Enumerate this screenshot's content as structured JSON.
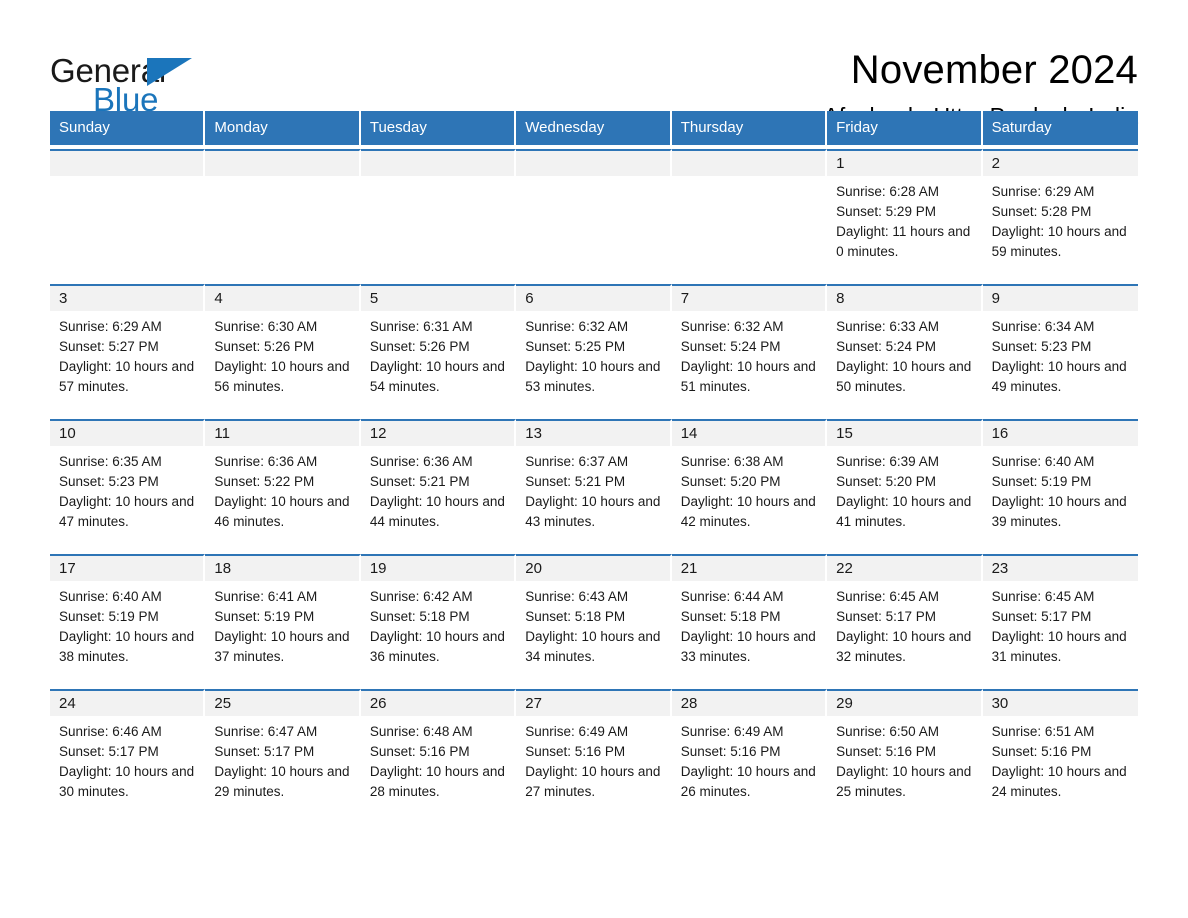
{
  "brand": {
    "name_part1": "General",
    "name_part2": "Blue",
    "triangle_color": "#1b75bb"
  },
  "header": {
    "title": "November 2024",
    "subtitle": "Afzalgarh, Uttar Pradesh, India"
  },
  "theme": {
    "header_blue": "#2e75b6",
    "band_gray": "#f2f2f2",
    "text_black": "#1a1a1a",
    "page_background": "#ffffff"
  },
  "weekday_headers": [
    "Sunday",
    "Monday",
    "Tuesday",
    "Wednesday",
    "Thursday",
    "Friday",
    "Saturday"
  ],
  "labels": {
    "sunrise_prefix": "Sunrise: ",
    "sunset_prefix": "Sunset: ",
    "daylight_prefix": "Daylight: "
  },
  "weeks": [
    [
      {
        "day": "",
        "sunrise": "",
        "sunset": "",
        "daylight": "",
        "empty": true
      },
      {
        "day": "",
        "sunrise": "",
        "sunset": "",
        "daylight": "",
        "empty": true
      },
      {
        "day": "",
        "sunrise": "",
        "sunset": "",
        "daylight": "",
        "empty": true
      },
      {
        "day": "",
        "sunrise": "",
        "sunset": "",
        "daylight": "",
        "empty": true
      },
      {
        "day": "",
        "sunrise": "",
        "sunset": "",
        "daylight": "",
        "empty": true
      },
      {
        "day": "1",
        "sunrise": "Sunrise: 6:28 AM",
        "sunset": "Sunset: 5:29 PM",
        "daylight": "Daylight: 11 hours and 0 minutes."
      },
      {
        "day": "2",
        "sunrise": "Sunrise: 6:29 AM",
        "sunset": "Sunset: 5:28 PM",
        "daylight": "Daylight: 10 hours and 59 minutes."
      }
    ],
    [
      {
        "day": "3",
        "sunrise": "Sunrise: 6:29 AM",
        "sunset": "Sunset: 5:27 PM",
        "daylight": "Daylight: 10 hours and 57 minutes."
      },
      {
        "day": "4",
        "sunrise": "Sunrise: 6:30 AM",
        "sunset": "Sunset: 5:26 PM",
        "daylight": "Daylight: 10 hours and 56 minutes."
      },
      {
        "day": "5",
        "sunrise": "Sunrise: 6:31 AM",
        "sunset": "Sunset: 5:26 PM",
        "daylight": "Daylight: 10 hours and 54 minutes."
      },
      {
        "day": "6",
        "sunrise": "Sunrise: 6:32 AM",
        "sunset": "Sunset: 5:25 PM",
        "daylight": "Daylight: 10 hours and 53 minutes."
      },
      {
        "day": "7",
        "sunrise": "Sunrise: 6:32 AM",
        "sunset": "Sunset: 5:24 PM",
        "daylight": "Daylight: 10 hours and 51 minutes."
      },
      {
        "day": "8",
        "sunrise": "Sunrise: 6:33 AM",
        "sunset": "Sunset: 5:24 PM",
        "daylight": "Daylight: 10 hours and 50 minutes."
      },
      {
        "day": "9",
        "sunrise": "Sunrise: 6:34 AM",
        "sunset": "Sunset: 5:23 PM",
        "daylight": "Daylight: 10 hours and 49 minutes."
      }
    ],
    [
      {
        "day": "10",
        "sunrise": "Sunrise: 6:35 AM",
        "sunset": "Sunset: 5:23 PM",
        "daylight": "Daylight: 10 hours and 47 minutes."
      },
      {
        "day": "11",
        "sunrise": "Sunrise: 6:36 AM",
        "sunset": "Sunset: 5:22 PM",
        "daylight": "Daylight: 10 hours and 46 minutes."
      },
      {
        "day": "12",
        "sunrise": "Sunrise: 6:36 AM",
        "sunset": "Sunset: 5:21 PM",
        "daylight": "Daylight: 10 hours and 44 minutes."
      },
      {
        "day": "13",
        "sunrise": "Sunrise: 6:37 AM",
        "sunset": "Sunset: 5:21 PM",
        "daylight": "Daylight: 10 hours and 43 minutes."
      },
      {
        "day": "14",
        "sunrise": "Sunrise: 6:38 AM",
        "sunset": "Sunset: 5:20 PM",
        "daylight": "Daylight: 10 hours and 42 minutes."
      },
      {
        "day": "15",
        "sunrise": "Sunrise: 6:39 AM",
        "sunset": "Sunset: 5:20 PM",
        "daylight": "Daylight: 10 hours and 41 minutes."
      },
      {
        "day": "16",
        "sunrise": "Sunrise: 6:40 AM",
        "sunset": "Sunset: 5:19 PM",
        "daylight": "Daylight: 10 hours and 39 minutes."
      }
    ],
    [
      {
        "day": "17",
        "sunrise": "Sunrise: 6:40 AM",
        "sunset": "Sunset: 5:19 PM",
        "daylight": "Daylight: 10 hours and 38 minutes."
      },
      {
        "day": "18",
        "sunrise": "Sunrise: 6:41 AM",
        "sunset": "Sunset: 5:19 PM",
        "daylight": "Daylight: 10 hours and 37 minutes."
      },
      {
        "day": "19",
        "sunrise": "Sunrise: 6:42 AM",
        "sunset": "Sunset: 5:18 PM",
        "daylight": "Daylight: 10 hours and 36 minutes."
      },
      {
        "day": "20",
        "sunrise": "Sunrise: 6:43 AM",
        "sunset": "Sunset: 5:18 PM",
        "daylight": "Daylight: 10 hours and 34 minutes."
      },
      {
        "day": "21",
        "sunrise": "Sunrise: 6:44 AM",
        "sunset": "Sunset: 5:18 PM",
        "daylight": "Daylight: 10 hours and 33 minutes."
      },
      {
        "day": "22",
        "sunrise": "Sunrise: 6:45 AM",
        "sunset": "Sunset: 5:17 PM",
        "daylight": "Daylight: 10 hours and 32 minutes."
      },
      {
        "day": "23",
        "sunrise": "Sunrise: 6:45 AM",
        "sunset": "Sunset: 5:17 PM",
        "daylight": "Daylight: 10 hours and 31 minutes."
      }
    ],
    [
      {
        "day": "24",
        "sunrise": "Sunrise: 6:46 AM",
        "sunset": "Sunset: 5:17 PM",
        "daylight": "Daylight: 10 hours and 30 minutes."
      },
      {
        "day": "25",
        "sunrise": "Sunrise: 6:47 AM",
        "sunset": "Sunset: 5:17 PM",
        "daylight": "Daylight: 10 hours and 29 minutes."
      },
      {
        "day": "26",
        "sunrise": "Sunrise: 6:48 AM",
        "sunset": "Sunset: 5:16 PM",
        "daylight": "Daylight: 10 hours and 28 minutes."
      },
      {
        "day": "27",
        "sunrise": "Sunrise: 6:49 AM",
        "sunset": "Sunset: 5:16 PM",
        "daylight": "Daylight: 10 hours and 27 minutes."
      },
      {
        "day": "28",
        "sunrise": "Sunrise: 6:49 AM",
        "sunset": "Sunset: 5:16 PM",
        "daylight": "Daylight: 10 hours and 26 minutes."
      },
      {
        "day": "29",
        "sunrise": "Sunrise: 6:50 AM",
        "sunset": "Sunset: 5:16 PM",
        "daylight": "Daylight: 10 hours and 25 minutes."
      },
      {
        "day": "30",
        "sunrise": "Sunrise: 6:51 AM",
        "sunset": "Sunset: 5:16 PM",
        "daylight": "Daylight: 10 hours and 24 minutes."
      }
    ]
  ]
}
